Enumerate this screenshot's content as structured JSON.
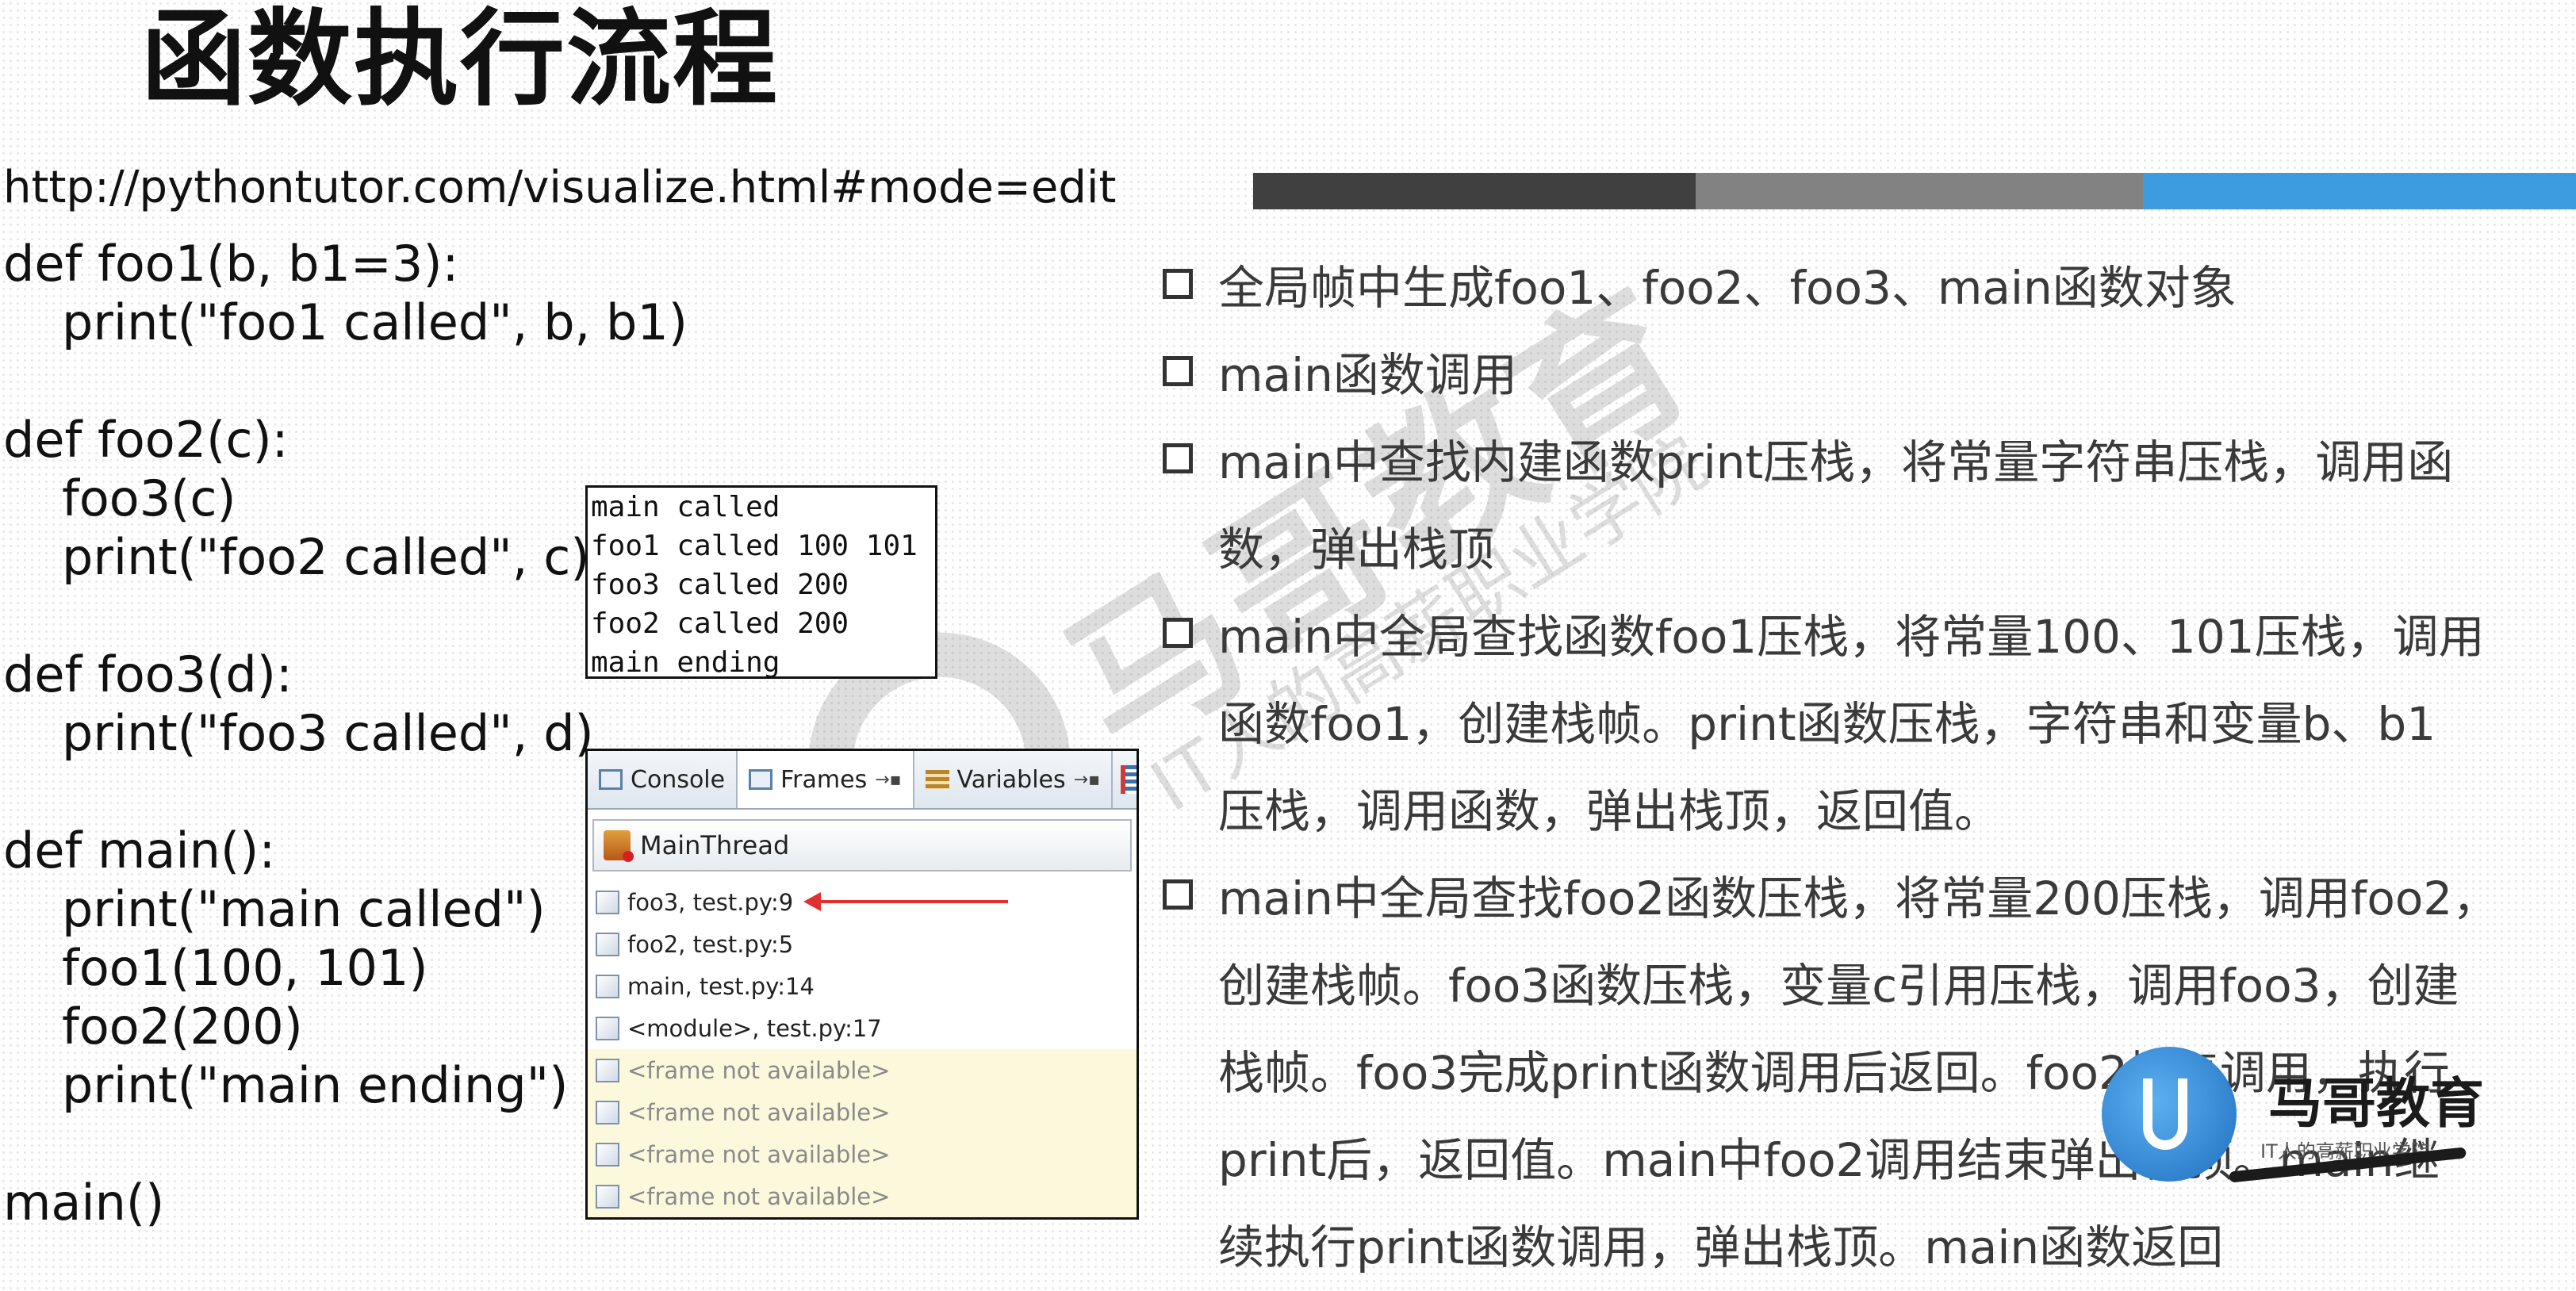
{
  "title": "函数执行流程",
  "url": "http://pythontutor.com/visualize.html#mode=edit",
  "code": [
    {
      "text": "def foo1(b, b1=3):",
      "indent": false
    },
    {
      "text": "print(\"foo1 called\", b, b1)",
      "indent": true
    },
    {
      "text": "",
      "indent": false
    },
    {
      "text": "def foo2(c):",
      "indent": false
    },
    {
      "text": "foo3(c)",
      "indent": true
    },
    {
      "text": "print(\"foo2 called\", c)",
      "indent": true
    },
    {
      "text": "",
      "indent": false
    },
    {
      "text": "def foo3(d):",
      "indent": false
    },
    {
      "text": "print(\"foo3 called\", d)",
      "indent": true
    },
    {
      "text": "",
      "indent": false
    },
    {
      "text": "def main():",
      "indent": false
    },
    {
      "text": "print(\"main called\")",
      "indent": true
    },
    {
      "text": "foo1(100, 101)",
      "indent": true
    },
    {
      "text": "foo2(200)",
      "indent": true
    },
    {
      "text": "print(\"main ending\")",
      "indent": true
    },
    {
      "text": "",
      "indent": false
    },
    {
      "text": "main()",
      "indent": false
    }
  ],
  "console_output": [
    "main called",
    "foo1 called 100 101",
    "foo3 called 200",
    "foo2 called 200",
    "main ending"
  ],
  "debugger": {
    "tabs": [
      "Console",
      "Frames",
      "Variables"
    ],
    "active_tab": "Frames",
    "thread": "MainThread",
    "frames": [
      {
        "label": "foo3, test.py:9",
        "available": true
      },
      {
        "label": "foo2, test.py:5",
        "available": true
      },
      {
        "label": "main, test.py:14",
        "available": true
      },
      {
        "label": "<module>, test.py:17",
        "available": true
      },
      {
        "label": "<frame not available>",
        "available": false
      },
      {
        "label": "<frame not available>",
        "available": false
      },
      {
        "label": "<frame not available>",
        "available": false
      },
      {
        "label": "<frame not available>",
        "available": false
      }
    ]
  },
  "bullets": [
    "全局帧中生成foo1、foo2、foo3、main函数对象",
    "main函数调用",
    "main中查找内建函数print压栈，将常量字符串压栈，调用函\n数，弹出栈顶",
    "main中全局查找函数foo1压栈，将常量100、101压栈，调用\n函数foo1，创建栈帧。print函数压栈，字符串和变量b、b1\n压栈，调用函数，弹出栈顶，返回值。",
    "main中全局查找foo2函数压栈，将常量200压栈，调用foo2，\n创建栈帧。foo3函数压栈，变量c引用压栈，调用foo3，创建\n栈帧。foo3完成print函数调用后返回。foo2恢复调用，执行\nprint后，返回值。main中foo2调用结束弹出栈顶。main继\n续执行print函数调用，弹出栈顶。main函数返回"
  ],
  "logo": {
    "name": "马哥教育",
    "tagline": "IT人的高薪职业学院"
  },
  "colors": {
    "stripe_dark": "#404040",
    "stripe_mid": "#828282",
    "stripe_blue": "#3d9be0",
    "arrow": "#e03030"
  }
}
